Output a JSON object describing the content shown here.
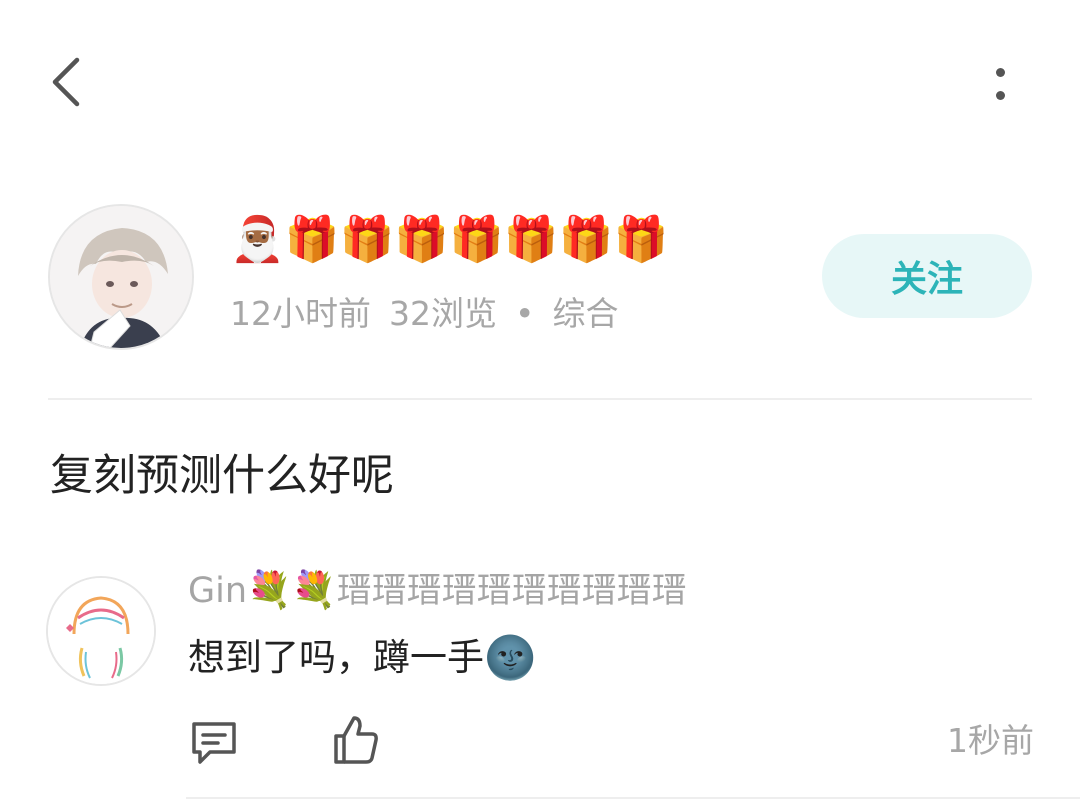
{
  "topbar": {
    "back_icon": "chevron-left-icon",
    "more_icon": "more-vertical-icon"
  },
  "author": {
    "avatar_icon": "user-avatar",
    "name": "🎅🏾🎁🎁🎁🎁🎁🎁🎁",
    "time": "12小时前",
    "views": "32浏览",
    "separator": "•",
    "category": "综合",
    "follow_label": "关注"
  },
  "post": {
    "text": "复刻预测什么好呢"
  },
  "comment": {
    "avatar_icon": "user-avatar",
    "name_prefix": "Gin",
    "name_emoji": "💐💐",
    "name_suffix": "瑨瑨瑨瑨瑨瑨瑨瑨瑨瑨",
    "text": "想到了吗，蹲一手",
    "text_emoji": "🌚",
    "reply_icon": "comment-icon",
    "like_icon": "thumbs-up-icon",
    "time": "1秒前"
  },
  "colors": {
    "accent": "#2cb4b8",
    "follow_bg": "#e7f7f7",
    "muted_text": "#a7a7a7",
    "divider": "#eeeeee"
  }
}
